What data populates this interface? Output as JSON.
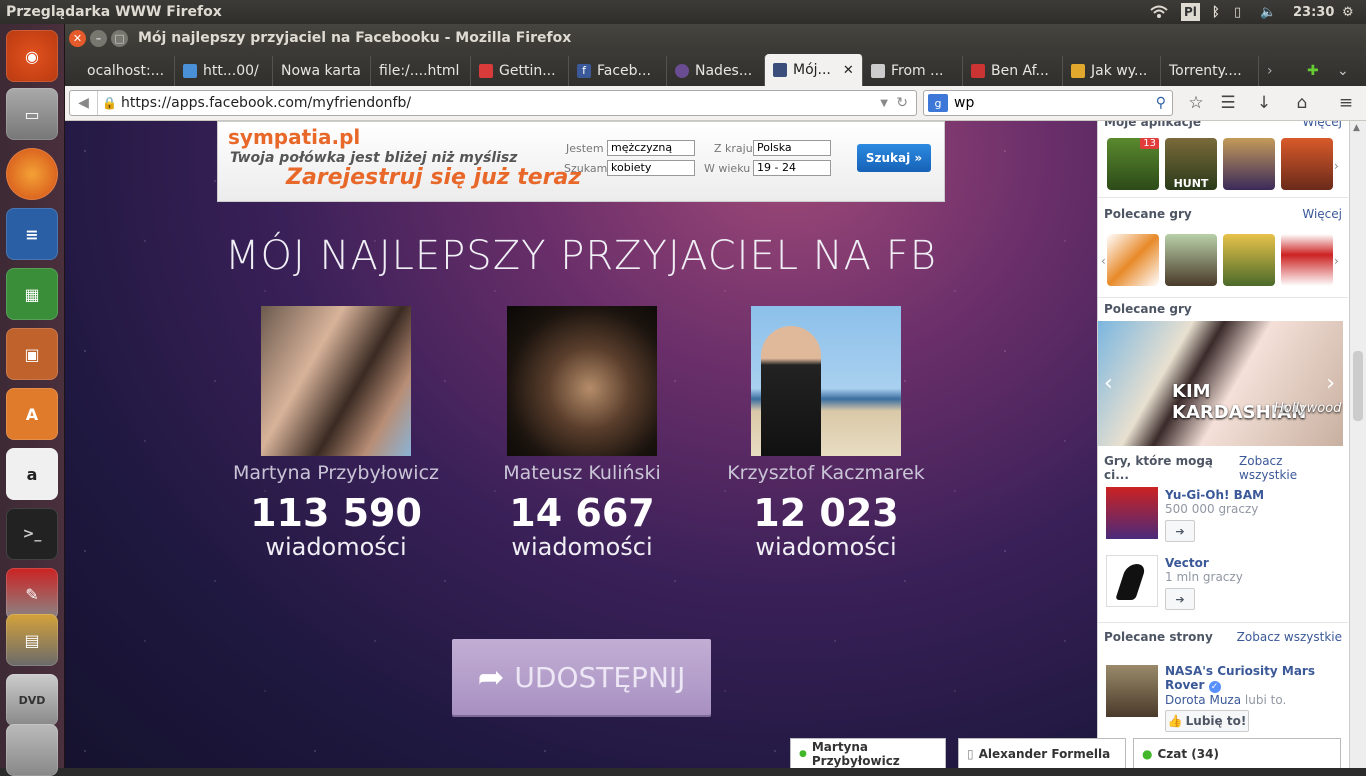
{
  "system": {
    "app_title": "Przeglądarka WWW Firefox",
    "time": "23:30",
    "keyboard_layout": "Pl"
  },
  "window": {
    "title": "Mój najlepszy przyjaciel na Facebooku - Mozilla Firefox"
  },
  "tabs": [
    {
      "label": "ocalhost:...",
      "icon": "page-icon",
      "color": "#888888"
    },
    {
      "label": "htt...00/",
      "icon": "network-icon",
      "color": "#4a90d9"
    },
    {
      "label": "Nowa karta",
      "icon": "",
      "color": ""
    },
    {
      "label": "file:/....html",
      "icon": "",
      "color": ""
    },
    {
      "label": "Gettin...",
      "icon": "flag-icon",
      "color": "#d93a3a"
    },
    {
      "label": "Faceb...",
      "icon": "facebook-icon",
      "color": "#3b5998"
    },
    {
      "label": "Nades...",
      "icon": "alien-icon",
      "color": "#6a4c93"
    },
    {
      "label": "Mój...",
      "icon": "app-icon",
      "color": "#3b4d7a",
      "active": true
    },
    {
      "label": "From ...",
      "icon": "mail-icon",
      "color": "#cccccc"
    },
    {
      "label": "Ben Af...",
      "icon": "pl-icon",
      "color": "#cc3333"
    },
    {
      "label": "Jak wy...",
      "icon": "trophy-icon",
      "color": "#e2a72d"
    },
    {
      "label": "Torrenty....",
      "icon": "",
      "color": ""
    }
  ],
  "navbar": {
    "url": "https://apps.facebook.com/myfriendonfb/",
    "search_value": "wp"
  },
  "ad": {
    "brand": "sympatia.pl",
    "tagline": "Twoja połówka jest bliżej niż myślisz",
    "cta": "Zarejestruj się już teraz",
    "jestem_label": "Jestem",
    "jestem_value": "mężczyzną",
    "szukam_label": "Szukam",
    "szukam_value": "kobiety",
    "kraj_label": "Z kraju",
    "kraj_value": "Polska",
    "wiek_label": "W wieku",
    "wiek_value": "19 - 24",
    "search_button": "Szukaj »"
  },
  "app": {
    "title": "MÓJ NAJLEPSZY PRZYJACIEL NA FB",
    "unit": "wiadomości",
    "share_button": "UDOSTĘPNIJ",
    "friends": [
      {
        "name": "Martyna Przybyłowicz",
        "count": "113 590"
      },
      {
        "name": "Mateusz Kuliński",
        "count": "14 667"
      },
      {
        "name": "Krzysztof Kaczmarek",
        "count": "12 023"
      }
    ]
  },
  "sidebar": {
    "my_apps_label": "Moje aplikacje",
    "my_apps_more": "Więcej",
    "my_apps_badge": "13",
    "my_apps_hunt_label": "HUNT",
    "rec_games_label": "Polecane gry",
    "rec_games_more": "Więcej",
    "featured_label": "Polecane gry",
    "featured_game_title": "KIM KARDASHIAN",
    "featured_game_sub": "Hollywood",
    "friends_games_label": "Gry, które mogą ci...",
    "friends_games_more": "Zobacz wszystkie",
    "games": [
      {
        "name": "Yu-Gi-Oh! BAM",
        "sub": "500 000 graczy"
      },
      {
        "name": "Vector",
        "sub": "1 mln graczy"
      }
    ],
    "pages_label": "Polecane strony",
    "pages_more": "Zobacz wszystkie",
    "page_name": "NASA's Curiosity Mars Rover",
    "page_liker": "Dorota Muza",
    "page_liker_suffix": "lubi to.",
    "like_button": "Lubię to!"
  },
  "chat": {
    "tab1": "Martyna Przybyłowicz",
    "tab2": "Alexander Formella",
    "tab3": "Czat (34)"
  }
}
